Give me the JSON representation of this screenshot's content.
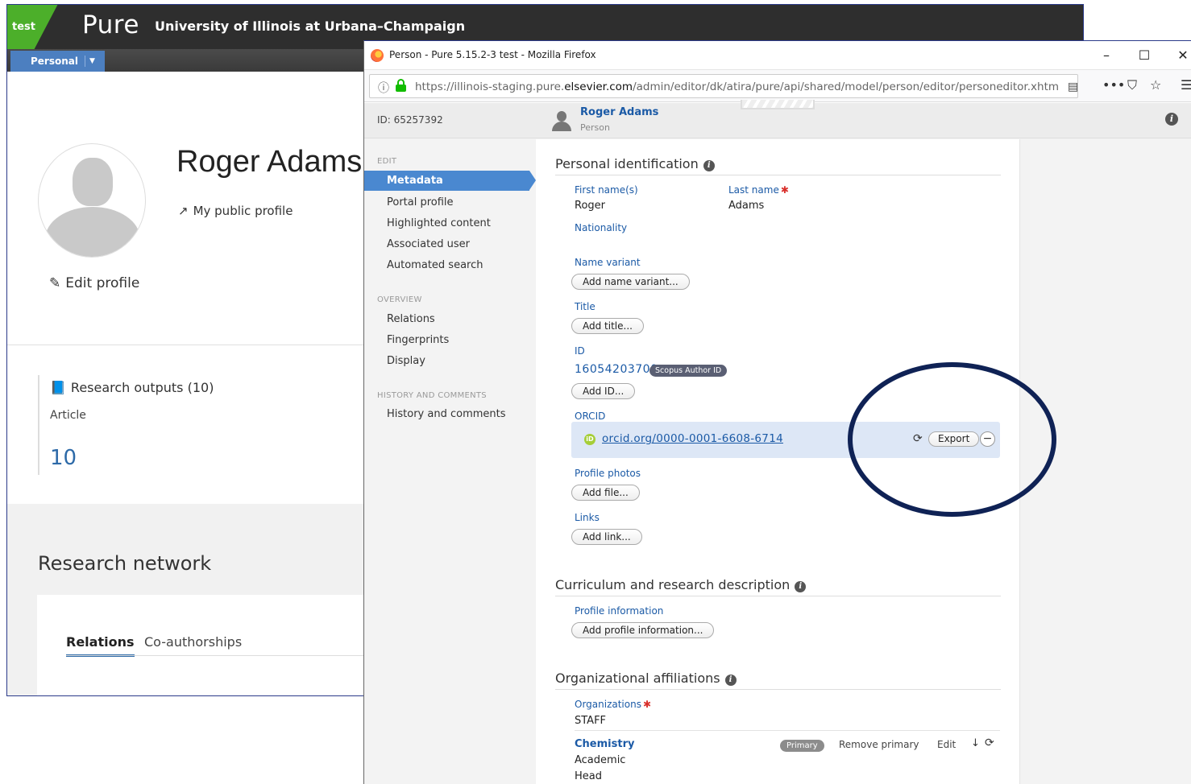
{
  "background_app": {
    "env_badge": "test",
    "logo": "Pure",
    "organization": "University of Illinois at Urbana–Champaign",
    "personal_button": "Personal",
    "profile_name": "Roger Adams",
    "public_profile_link": "My public profile",
    "edit_profile": "Edit profile",
    "research_outputs": {
      "title": "Research outputs (10)",
      "type": "Article",
      "count": "10"
    },
    "research_network": {
      "title": "Research network",
      "tabs": [
        "Relations",
        "Co-authorships"
      ]
    }
  },
  "browser": {
    "window_title": "Person - Pure 5.15.2-3 test - Mozilla Firefox",
    "url_prefix": "https://illinois-staging.pure.",
    "url_domain": "elsevier.com",
    "url_suffix": "/admin/editor/dk/atira/pure/api/shared/model/person/editor/personeditor.xhtml?sch",
    "window_buttons": {
      "minimize": "–",
      "maximize": "☐",
      "close": "✕"
    },
    "toolbar_icons": {
      "more": "•••",
      "pocket": "⛉",
      "bookmark": "☆",
      "menu": "☰"
    }
  },
  "editor": {
    "id_text": "ID: 65257392",
    "person_name": "Roger Adams",
    "person_type": "Person",
    "sidebar": {
      "edit_section": "EDIT",
      "edit_items": [
        "Metadata",
        "Portal profile",
        "Highlighted content",
        "Associated user",
        "Automated search"
      ],
      "overview_section": "OVERVIEW",
      "overview_items": [
        "Relations",
        "Fingerprints",
        "Display"
      ],
      "history_section": "HISTORY AND COMMENTS",
      "history_items": [
        "History and comments"
      ]
    },
    "personal_identification": {
      "title": "Personal identification",
      "first_name_label": "First name(s)",
      "first_name": "Roger",
      "last_name_label": "Last name",
      "last_name": "Adams",
      "nationality_label": "Nationality",
      "name_variant_label": "Name variant",
      "add_name_variant": "Add name variant...",
      "title_label": "Title",
      "add_title": "Add title...",
      "id_label": "ID",
      "id_value": "16054203700",
      "id_badge": "Scopus Author ID",
      "add_id": "Add ID...",
      "orcid_label": "ORCID",
      "orcid_link": "orcid.org/0000-0001-6608-6714",
      "orcid_export": "Export",
      "profile_photos_label": "Profile photos",
      "add_file": "Add file...",
      "links_label": "Links",
      "add_link": "Add link..."
    },
    "curriculum": {
      "title": "Curriculum and research description",
      "profile_information_label": "Profile information",
      "add_profile_information": "Add profile information..."
    },
    "affiliations": {
      "title": "Organizational affiliations",
      "organizations_label": "Organizations",
      "staff": "STAFF",
      "org_name": "Chemistry",
      "primary_badge": "Primary",
      "remove_primary": "Remove primary",
      "edit": "Edit",
      "org_type": "Academic",
      "org_role": "Head"
    }
  },
  "colors": {
    "accent_blue": "#4a88d0",
    "link_blue": "#1b5aa6",
    "env_green": "#4caf2a",
    "highlight_circle": "#0f2255"
  }
}
